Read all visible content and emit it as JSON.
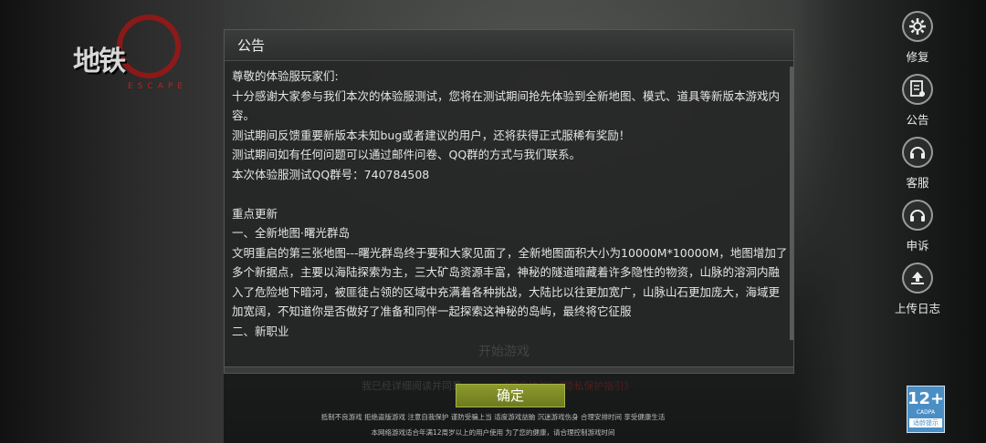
{
  "logo": {
    "text": "地铁",
    "sub": "ESCAPE"
  },
  "dialog": {
    "title": "公告",
    "lines": [
      "尊敬的体验服玩家们:",
      "十分感谢大家参与我们本次的体验服测试，您将在测试期间抢先体验到全新地图、模式、道具等新版本游戏内容。",
      "测试期间反馈重要新版本未知bug或者建议的用户，还将获得正式服稀有奖励！",
      "测试期间如有任何问题可以通过邮件问卷、QQ群的方式与我们联系。",
      "本次体验服测试QQ群号：740784508",
      "",
      "重点更新",
      "一、全新地图·曙光群岛",
      "文明重启的第三张地图---曙光群岛终于要和大家见面了，全新地图面积大小为10000M*10000M，地图增加了多个新据点，主要以海陆探索为主，三大矿岛资源丰富，神秘的隧道暗藏着许多隐性的物资，山脉的溶洞内融入了危险地下暗河，被匪徒占领的区域中充满着各种挑战，大陆比以往更加宽广，山脉山石更加庞大，海域更加宽阔，不知道你是否做好了准备和同伴一起探索这神秘的岛屿，最终将它征服",
      "二、新职业"
    ],
    "behind_button": "开始游戏",
    "behind_checkbox": "我已经详细阅读并同意",
    "behind_links": "《用户协议》《隐私保护指引》"
  },
  "confirm_label": "确定",
  "notice_line1": "抵制不良游戏 拒绝盗版游戏 注意自我保护 谨防受骗上当 适度游戏益脑 沉迷游戏伤身 合理安排时间 享受健康生活",
  "notice_line2": "本网络游戏适合年满12周岁以上的用户使用   为了您的健康，请合理控制游戏时间",
  "menu": [
    {
      "label": "修复",
      "icon": "gear-icon"
    },
    {
      "label": "公告",
      "icon": "notice-icon"
    },
    {
      "label": "客服",
      "icon": "headset-icon"
    },
    {
      "label": "申诉",
      "icon": "headset-icon"
    },
    {
      "label": "上传日志",
      "icon": "upload-icon"
    }
  ],
  "age_badge": {
    "number": "12+",
    "org": "CADPA",
    "text": "适龄提示"
  }
}
